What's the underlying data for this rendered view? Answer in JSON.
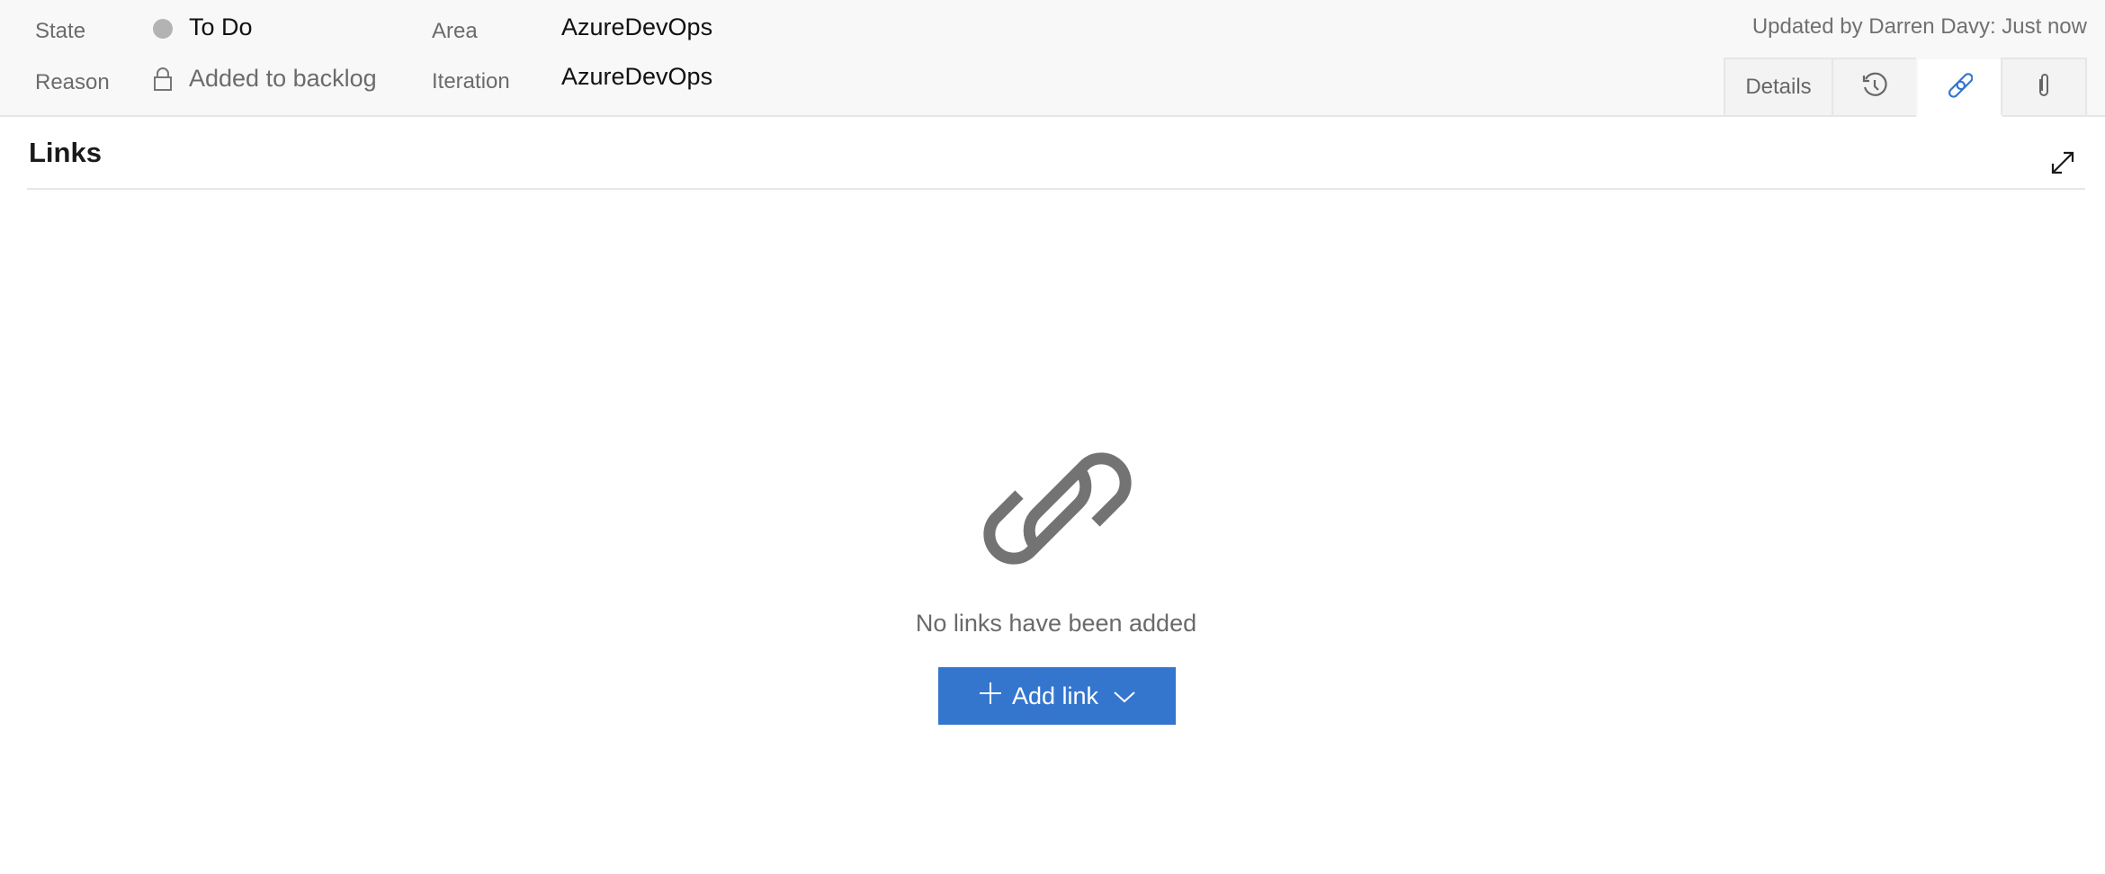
{
  "header": {
    "state_label": "State",
    "state_value": "To Do",
    "state_color": "#b3b3b3",
    "reason_label": "Reason",
    "reason_value": "Added to backlog",
    "area_label": "Area",
    "area_value": "AzureDevOps",
    "iteration_label": "Iteration",
    "iteration_value": "AzureDevOps",
    "updated": "Updated by Darren Davy: Just now"
  },
  "tabs": [
    {
      "label": "Details",
      "icon": null
    },
    {
      "icon": "history-icon"
    },
    {
      "icon": "link-icon",
      "active": true
    },
    {
      "icon": "paperclip-icon"
    }
  ],
  "panel": {
    "title": "Links",
    "empty_text": "No links have been added",
    "add_link_label": "Add link",
    "accent": "#3476ce"
  }
}
